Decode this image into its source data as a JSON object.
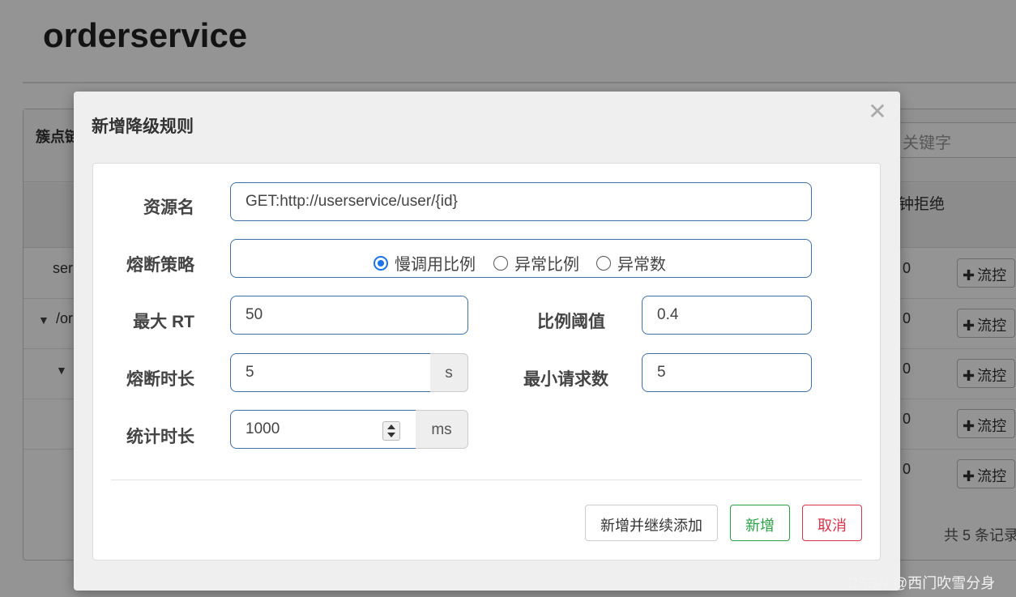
{
  "page": {
    "title": "orderservice",
    "panel_heading": "簇点链",
    "search_placeholder": "关键字",
    "column_header": "钟拒绝",
    "rows": [
      {
        "label": "ser",
        "count": "0",
        "action": "流控"
      },
      {
        "label": "/or",
        "count": "0",
        "action": "流控"
      },
      {
        "label": "",
        "count": "0",
        "action": "流控"
      },
      {
        "label": "",
        "count": "0",
        "action": "流控"
      },
      {
        "label": "",
        "count": "0",
        "action": "流控"
      }
    ],
    "total_records": "共 5 条记录"
  },
  "modal": {
    "title": "新增降级规则",
    "close_icon": "✕",
    "fields": {
      "resource": {
        "label": "资源名",
        "value": "GET:http://userservice/user/{id}"
      },
      "strategy": {
        "label": "熔断策略",
        "options": [
          "慢调用比例",
          "异常比例",
          "异常数"
        ],
        "selected": "慢调用比例"
      },
      "max_rt": {
        "label": "最大 RT",
        "value": "50"
      },
      "ratio_threshold": {
        "label": "比例阈值",
        "value": "0.4"
      },
      "break_duration": {
        "label": "熔断时长",
        "value": "5",
        "unit": "s"
      },
      "min_requests": {
        "label": "最小请求数",
        "value": "5"
      },
      "stat_duration": {
        "label": "统计时长",
        "value": "1000",
        "unit": "ms"
      }
    },
    "buttons": {
      "add_continue": "新增并继续添加",
      "add": "新增",
      "cancel": "取消"
    }
  },
  "watermark": "CSDN @西门吹雪分身",
  "colors": {
    "input_border": "#3e6fa8",
    "radio_accent": "#1a73e8",
    "success": "#2aa046",
    "danger": "#d9344a"
  }
}
